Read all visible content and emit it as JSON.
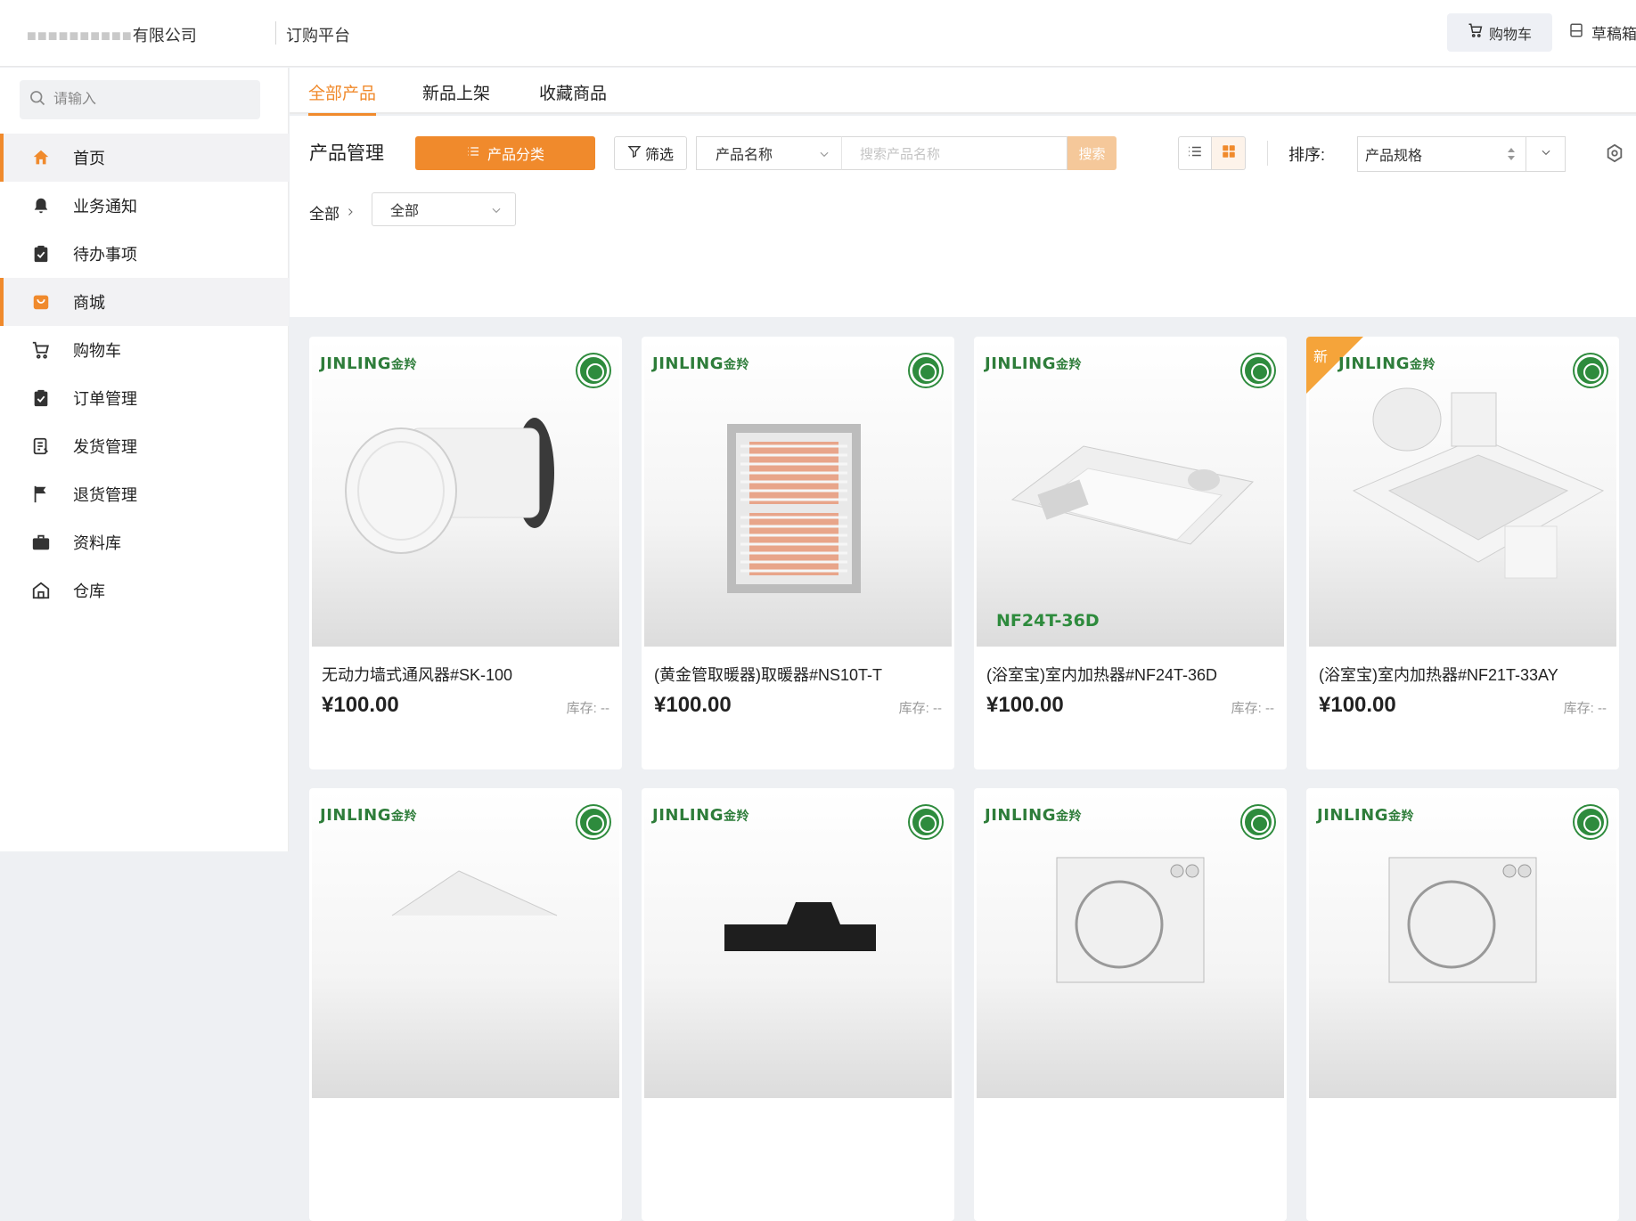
{
  "header": {
    "company_visible": "有限公司",
    "platform": "订购平台",
    "cart_label": "购物车",
    "draft_label": "草稿箱"
  },
  "sidebar": {
    "search_placeholder": "请输入",
    "items": [
      {
        "label": "首页",
        "icon": "home-icon",
        "active": true
      },
      {
        "label": "业务通知",
        "icon": "bell-icon",
        "active": false
      },
      {
        "label": "待办事项",
        "icon": "clipboard-check-icon",
        "active": false
      },
      {
        "label": "商城",
        "icon": "shop-bag-icon",
        "active": true
      },
      {
        "label": "购物车",
        "icon": "cart-icon",
        "active": false
      },
      {
        "label": "订单管理",
        "icon": "clipboard-check-icon",
        "active": false
      },
      {
        "label": "发货管理",
        "icon": "document-icon",
        "active": false
      },
      {
        "label": "退货管理",
        "icon": "flag-icon",
        "active": false
      },
      {
        "label": "资料库",
        "icon": "briefcase-icon",
        "active": false
      },
      {
        "label": "仓库",
        "icon": "warehouse-icon",
        "active": false
      }
    ]
  },
  "tabs": [
    {
      "label": "全部产品",
      "active": true
    },
    {
      "label": "新品上架",
      "active": false
    },
    {
      "label": "收藏商品",
      "active": false
    }
  ],
  "toolbar": {
    "title": "产品管理",
    "category_button": "产品分类",
    "filter_button": "筛选",
    "field_select": "产品名称",
    "search_placeholder": "搜索产品名称",
    "search_button": "搜索",
    "sort_label": "排序:",
    "sort_value": "产品规格"
  },
  "breadcrumb": {
    "root": "全部",
    "select_value": "全部"
  },
  "products": [
    {
      "brand": "JINLING",
      "brand_cn": "金羚",
      "name": "无动力墙式通风器#SK-100",
      "price": "¥100.00",
      "stock": "库存: --",
      "is_new": false,
      "model_tag": ""
    },
    {
      "brand": "JINLING",
      "brand_cn": "金羚",
      "name": "(黄金管取暖器)取暖器#NS10T-T",
      "price": "¥100.00",
      "stock": "库存: --",
      "is_new": false,
      "model_tag": ""
    },
    {
      "brand": "JINLING",
      "brand_cn": "金羚",
      "name": "(浴室宝)室内加热器#NF24T-36D",
      "price": "¥100.00",
      "stock": "库存: --",
      "is_new": false,
      "model_tag": "NF24T-36D"
    },
    {
      "brand": "JINLING",
      "brand_cn": "金羚",
      "name": "(浴室宝)室内加热器#NF21T-33AY",
      "price": "¥100.00",
      "stock": "库存: --",
      "is_new": true,
      "new_label": "新",
      "model_tag": ""
    },
    {
      "brand": "JINLING",
      "brand_cn": "金羚",
      "name": "",
      "price": "",
      "stock": "",
      "is_new": false,
      "model_tag": ""
    },
    {
      "brand": "JINLING",
      "brand_cn": "金羚",
      "name": "",
      "price": "",
      "stock": "",
      "is_new": false,
      "model_tag": ""
    },
    {
      "brand": "JINLING",
      "brand_cn": "金羚",
      "name": "",
      "price": "",
      "stock": "",
      "is_new": false,
      "model_tag": ""
    },
    {
      "brand": "JINLING",
      "brand_cn": "金羚",
      "name": "",
      "price": "",
      "stock": "",
      "is_new": false,
      "model_tag": ""
    }
  ],
  "colors": {
    "accent": "#f08a2c",
    "brand_green": "#2e8b3d"
  }
}
